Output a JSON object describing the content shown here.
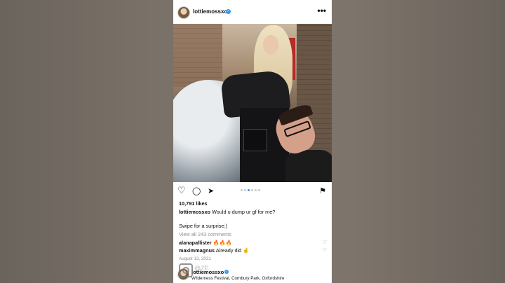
{
  "post": {
    "username": "lottiemossxo",
    "verified_mark": "✓",
    "more_icon": "•••",
    "likes": "10,791 likes",
    "caption_user": "lottiemossxo",
    "caption_text": "Would u dump ur gf for me?",
    "caption_line2": "Swipe for a surprise:)",
    "view_comments": "View all 243 comments",
    "comments": [
      {
        "user": "alanapallister",
        "text": "🔥🔥🔥"
      },
      {
        "user": "maximmagnus",
        "text": "Already did 🤞"
      }
    ],
    "date": "August 13, 2021"
  },
  "icons": {
    "heart": "♡",
    "comment": "◯",
    "share": "➤",
    "save": "⚑"
  },
  "footer": {
    "username": "lottiemossxo",
    "location": "Wilderness Festival, Cornbury Park, Oxfordshire",
    "watermark_text": "@ZE"
  },
  "colors": {
    "accent": "#3897f0",
    "background": "#6f675f"
  }
}
